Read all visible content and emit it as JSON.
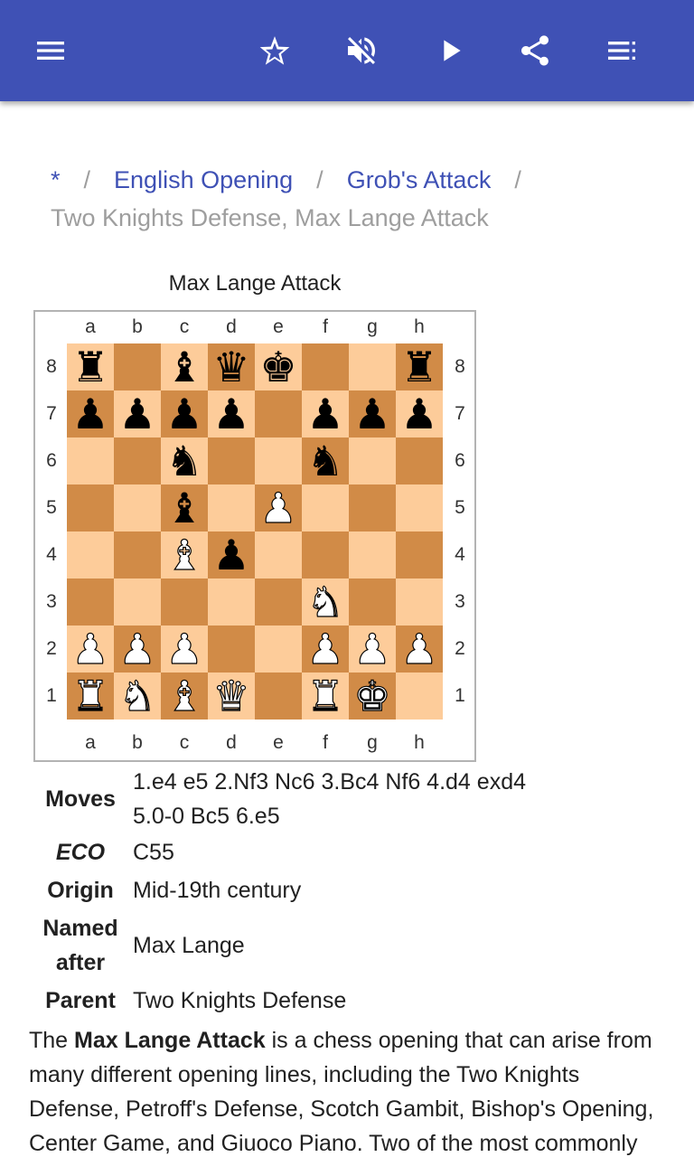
{
  "appbar": {
    "background": "#3f51b5",
    "icons": [
      "menu-icon",
      "star-outline-icon",
      "volume-off-icon",
      "play-icon",
      "share-icon",
      "playlist-icon"
    ]
  },
  "breadcrumb": {
    "items": [
      {
        "label": "*",
        "link": true
      },
      {
        "label": "English Opening",
        "link": true
      },
      {
        "label": "Grob's Attack",
        "link": true
      }
    ],
    "separator": "/",
    "current": "Two Knights Defense, Max Lange Attack"
  },
  "board": {
    "caption": "Max Lange Attack",
    "files": [
      "a",
      "b",
      "c",
      "d",
      "e",
      "f",
      "g",
      "h"
    ],
    "ranks": [
      "8",
      "7",
      "6",
      "5",
      "4",
      "3",
      "2",
      "1"
    ],
    "position": [
      [
        "br",
        "",
        "bb",
        "bq",
        "bk",
        "",
        "",
        "br"
      ],
      [
        "bp",
        "bp",
        "bp",
        "bp",
        "",
        "bp",
        "bp",
        "bp"
      ],
      [
        "",
        "",
        "bn",
        "",
        "",
        "bn",
        "",
        ""
      ],
      [
        "",
        "",
        "bb",
        "",
        "wp",
        "",
        "",
        ""
      ],
      [
        "",
        "",
        "wb",
        "bp",
        "",
        "",
        "",
        ""
      ],
      [
        "",
        "",
        "",
        "",
        "",
        "wn",
        "",
        ""
      ],
      [
        "wp",
        "wp",
        "wp",
        "",
        "",
        "wp",
        "wp",
        "wp"
      ],
      [
        "wr",
        "wn",
        "wb",
        "wq",
        "",
        "wr",
        "wk",
        ""
      ]
    ],
    "light_color": "#fdcc9a",
    "dark_color": "#d18b47"
  },
  "info": {
    "moves_label": "Moves",
    "moves_line1": "1.e4 e5 2.Nf3 Nc6 3.Bc4 Nf6 4.d4 exd4",
    "moves_line2": "5.0-0 Bc5 6.e5",
    "eco_label": "ECO",
    "eco_value": "C55",
    "origin_label": "Origin",
    "origin_value": "Mid-19th century",
    "named_label_1": "Named",
    "named_label_2": "after",
    "named_value": "Max Lange",
    "parent_label": "Parent",
    "parent_value": "Two Knights Defense"
  },
  "article": {
    "intro_the": "The ",
    "intro_bold": "Max Lange Attack",
    "intro_rest": " is a chess opening that can arise from many different opening lines, including the Two Knights Defense, Petroff's Defense, Scotch Gambit, Bishop's Opening, Center Game, and Giuoco Piano. Two of the most commonly"
  }
}
